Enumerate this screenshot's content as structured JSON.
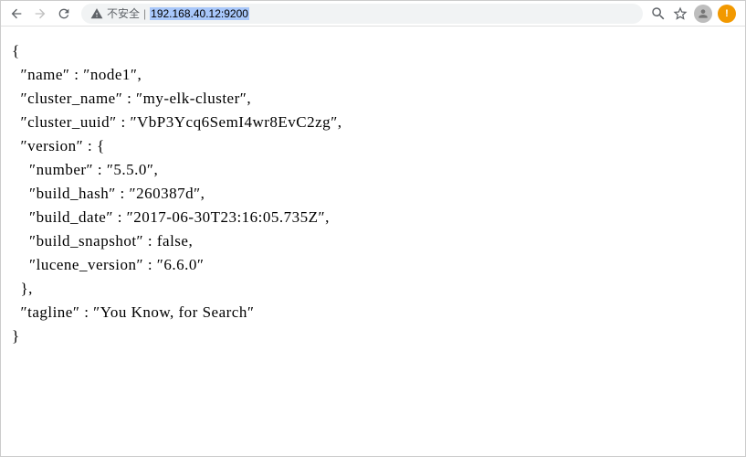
{
  "toolbar": {
    "security_label": "不安全",
    "url": "192.168.40.12:9200"
  },
  "response": {
    "name_key": "name",
    "name_val": "node1",
    "cluster_name_key": "cluster_name",
    "cluster_name_val": "my-elk-cluster",
    "cluster_uuid_key": "cluster_uuid",
    "cluster_uuid_val": "VbP3Ycq6SemI4wr8EvC2zg",
    "version_key": "version",
    "number_key": "number",
    "number_val": "5.5.0",
    "build_hash_key": "build_hash",
    "build_hash_val": "260387d",
    "build_date_key": "build_date",
    "build_date_val": "2017-06-30T23:16:05.735Z",
    "build_snapshot_key": "build_snapshot",
    "build_snapshot_val": "false",
    "lucene_version_key": "lucene_version",
    "lucene_version_val": "6.6.0",
    "tagline_key": "tagline",
    "tagline_val": "You Know, for Search"
  }
}
